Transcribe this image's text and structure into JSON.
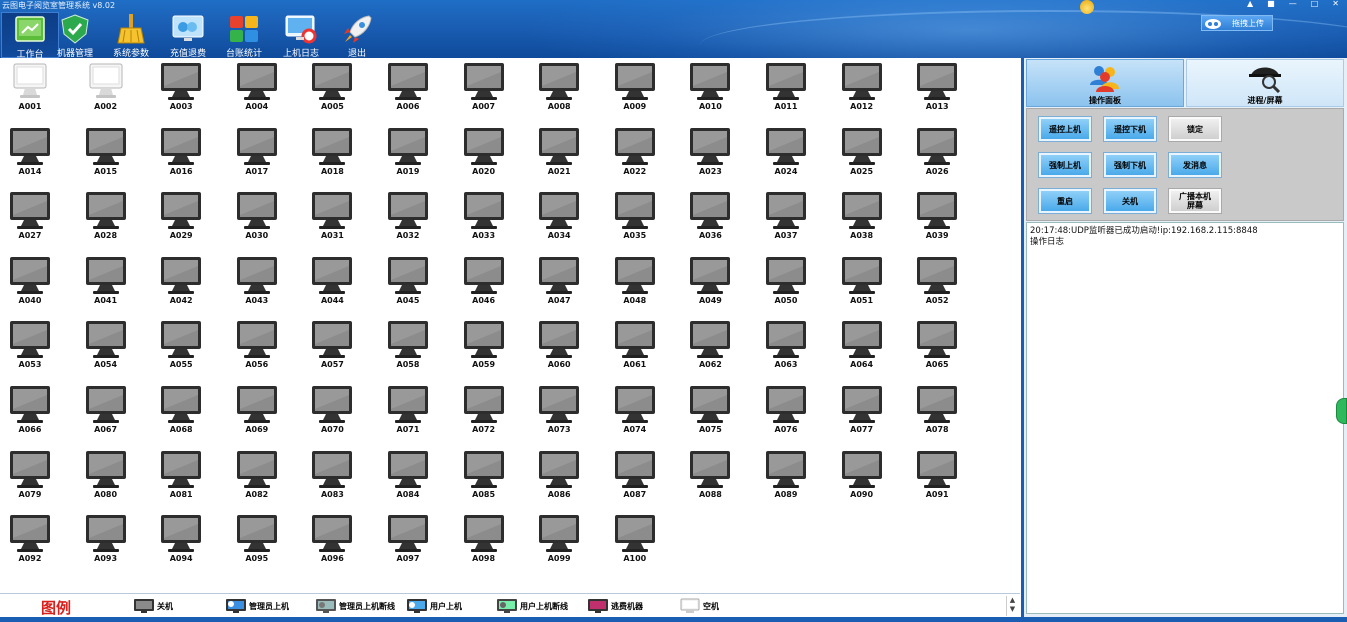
{
  "app": {
    "title": "云图电子阅览室管理系统 v8.02"
  },
  "toolbar": [
    {
      "key": "workbench",
      "label": "工作台",
      "icon": "workbench-icon",
      "active": true
    },
    {
      "key": "machines",
      "label": "机器管理",
      "icon": "shield-check-icon",
      "active": false
    },
    {
      "key": "params",
      "label": "系统参数",
      "icon": "broom-icon",
      "active": false
    },
    {
      "key": "recharge",
      "label": "充值退费",
      "icon": "recharge-monitor-icon",
      "active": false
    },
    {
      "key": "ledger",
      "label": "台账统计",
      "icon": "colorful-blocks-icon",
      "active": false
    },
    {
      "key": "logs",
      "label": "上机日志",
      "icon": "monitor-lifebuoy-icon",
      "active": false
    },
    {
      "key": "exit",
      "label": "退出",
      "icon": "rocket-icon",
      "active": false
    }
  ],
  "upload": {
    "label": "拖拽上传"
  },
  "window_controls": [
    "▲",
    "■",
    "—",
    "□",
    "✕"
  ],
  "computers": [
    "A001",
    "A002",
    "A003",
    "A004",
    "A005",
    "A006",
    "A007",
    "A008",
    "A009",
    "A010",
    "A011",
    "A012",
    "A013",
    "A014",
    "A015",
    "A016",
    "A017",
    "A018",
    "A019",
    "A020",
    "A021",
    "A022",
    "A023",
    "A024",
    "A025",
    "A026",
    "A027",
    "A028",
    "A029",
    "A030",
    "A031",
    "A032",
    "A033",
    "A034",
    "A035",
    "A036",
    "A037",
    "A038",
    "A039",
    "A040",
    "A041",
    "A042",
    "A043",
    "A044",
    "A045",
    "A046",
    "A047",
    "A048",
    "A049",
    "A050",
    "A051",
    "A052",
    "A053",
    "A054",
    "A055",
    "A056",
    "A057",
    "A058",
    "A059",
    "A060",
    "A061",
    "A062",
    "A063",
    "A064",
    "A065",
    "A066",
    "A067",
    "A068",
    "A069",
    "A070",
    "A071",
    "A072",
    "A073",
    "A074",
    "A075",
    "A076",
    "A077",
    "A078",
    "A079",
    "A080",
    "A081",
    "A082",
    "A083",
    "A084",
    "A085",
    "A086",
    "A087",
    "A088",
    "A089",
    "A090",
    "A091",
    "A092",
    "A093",
    "A094",
    "A095",
    "A096",
    "A097",
    "A098",
    "A099",
    "A100"
  ],
  "computer_states": {
    "A001": "idle",
    "A002": "idle",
    "default": "off"
  },
  "legend": {
    "title": "图例",
    "items": [
      {
        "label": "关机",
        "icon": "monitor-off-icon"
      },
      {
        "label": "管理员上机",
        "icon": "admin-online-icon"
      },
      {
        "label": "管理员上机断线",
        "icon": "admin-disconnected-icon"
      },
      {
        "label": "用户上机",
        "icon": "user-online-icon"
      },
      {
        "label": "用户上机断线",
        "icon": "user-disconnected-icon"
      },
      {
        "label": "逃费机器",
        "icon": "fee-evasion-icon"
      },
      {
        "label": "空机",
        "icon": "idle-machine-icon"
      }
    ],
    "scroll": [
      "▲",
      "▼"
    ]
  },
  "right_panel": {
    "tabs": [
      {
        "label": "操作面板",
        "icon": "users-group-icon",
        "active": true
      },
      {
        "label": "进程/屏幕",
        "icon": "spy-magnifier-icon",
        "active": false
      }
    ],
    "buttons": [
      {
        "label": "遥控上机",
        "style": "blue"
      },
      {
        "label": "遥控下机",
        "style": "blue"
      },
      {
        "label": "锁定",
        "style": "grey"
      },
      {
        "label": "强制上机",
        "style": "blue"
      },
      {
        "label": "强制下机",
        "style": "blue"
      },
      {
        "label": "发消息",
        "style": "blue"
      },
      {
        "label": "重启",
        "style": "blue"
      },
      {
        "label": "关机",
        "style": "blue"
      },
      {
        "label": "广播本机屏幕",
        "style": "grey"
      }
    ],
    "log": [
      "20:17:48:UDP监听器已成功启动!ip:192.168.2.115:8848",
      "操作日志"
    ]
  },
  "colors": {
    "top_bar": "#1a5eb3",
    "button_blue": "#4aa9ea",
    "legend_title": "#d9201d",
    "side_tab": "#2fb85c"
  }
}
